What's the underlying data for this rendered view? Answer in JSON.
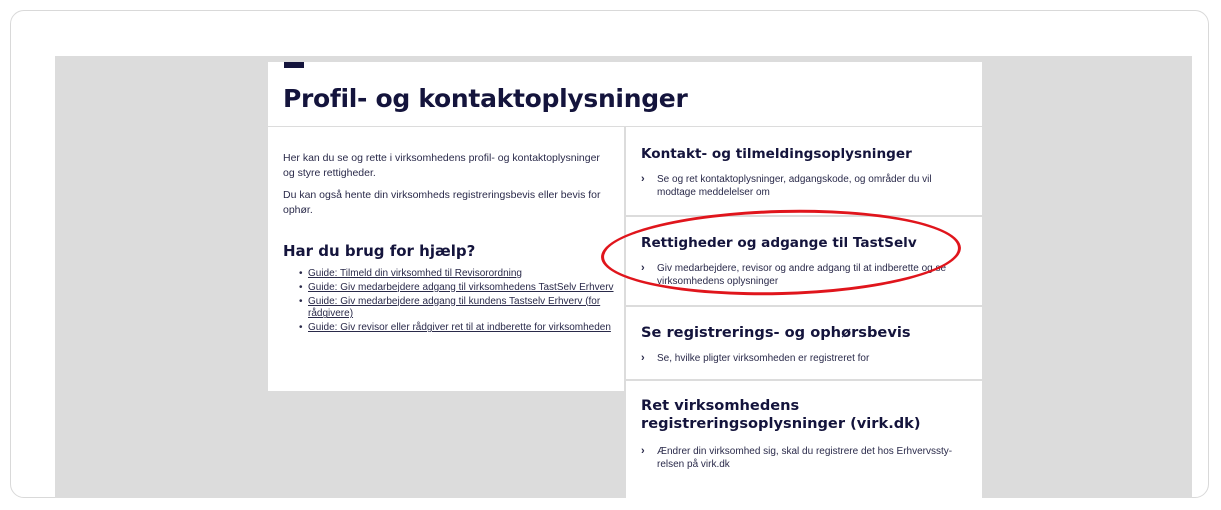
{
  "page": {
    "title": "Profil- og kontaktoplysninger"
  },
  "intro": {
    "paragraph1": "Her kan du se og rette i virksomhedens profil- og kontaktoplysninger og styre rettigheder.",
    "paragraph2": "Du kan også hente din virksomheds registreringsbevis eller bevis for ophør."
  },
  "help": {
    "heading": "Har du brug for hjælp?",
    "links": [
      "Guide: Tilmeld din virksomhed til Revisorordning",
      "Guide: Giv medarbejdere adgang til virksomhedens TastSelv Erhverv",
      "Guide: Giv medarbejdere adgang til kundens Tastselv Erhverv (for rådgivere)",
      "Guide: Giv revisor eller rådgiver ret til at indberette for virksomheden"
    ]
  },
  "cards": [
    {
      "title": "Kontakt- og tilmeldingsoplysninger",
      "description": "Se og ret kontaktoplysninger, adgangskode, og områder du vil modtage meddelelser om"
    },
    {
      "title": "Rettigheder og adgange til TastSelv",
      "description": "Giv medarbejdere, revisor og andre adgang til at indberette og se virksomhedens oplysninger"
    },
    {
      "title": "Se registrerings- og ophørsbevis",
      "description": "Se, hvilke pligter virksomheden er registreret for"
    },
    {
      "title": "Ret virksomhedens registreringsoplysninger (virk.dk)",
      "description": "Ændrer din virksomhed sig, skal du registrere det hos Erhvervssty-relsen på virk.dk"
    }
  ],
  "icons": {
    "chevron": "chevron-right-icon"
  },
  "colors": {
    "brand_navy": "#14143c",
    "highlight_red": "#e0151c",
    "backdrop_gray": "#dcdcdc"
  }
}
